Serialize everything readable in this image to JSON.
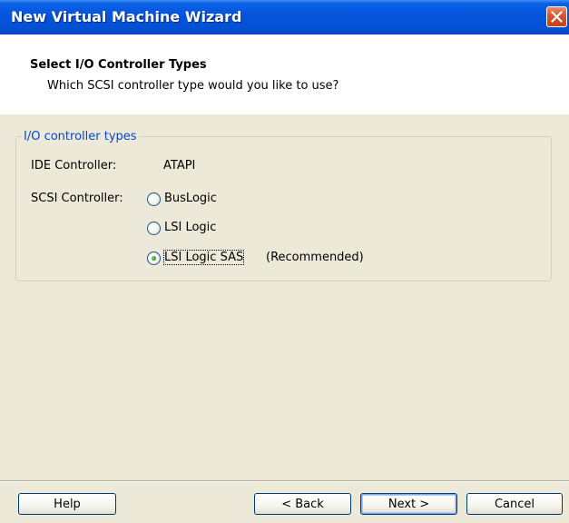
{
  "window": {
    "title": "New Virtual Machine Wizard"
  },
  "header": {
    "title": "Select I/O Controller Types",
    "subtitle": "Which SCSI controller type would you like to use?"
  },
  "group": {
    "legend": "I/O controller types",
    "ide_label": "IDE Controller:",
    "ide_value": "ATAPI",
    "scsi_label": "SCSI Controller:",
    "options": [
      {
        "label": "BusLogic",
        "selected": false
      },
      {
        "label": "LSI Logic",
        "selected": false
      },
      {
        "label": "LSI Logic SAS",
        "selected": true,
        "note": "(Recommended)"
      }
    ]
  },
  "buttons": {
    "help": "Help",
    "back": "< Back",
    "next": "Next >",
    "cancel": "Cancel"
  },
  "icons": {
    "close": "close-icon"
  },
  "colors": {
    "titlebar": "#0553dd",
    "close": "#d9542c",
    "legend": "#0046d5",
    "dialog_bg": "#ece9d8"
  }
}
